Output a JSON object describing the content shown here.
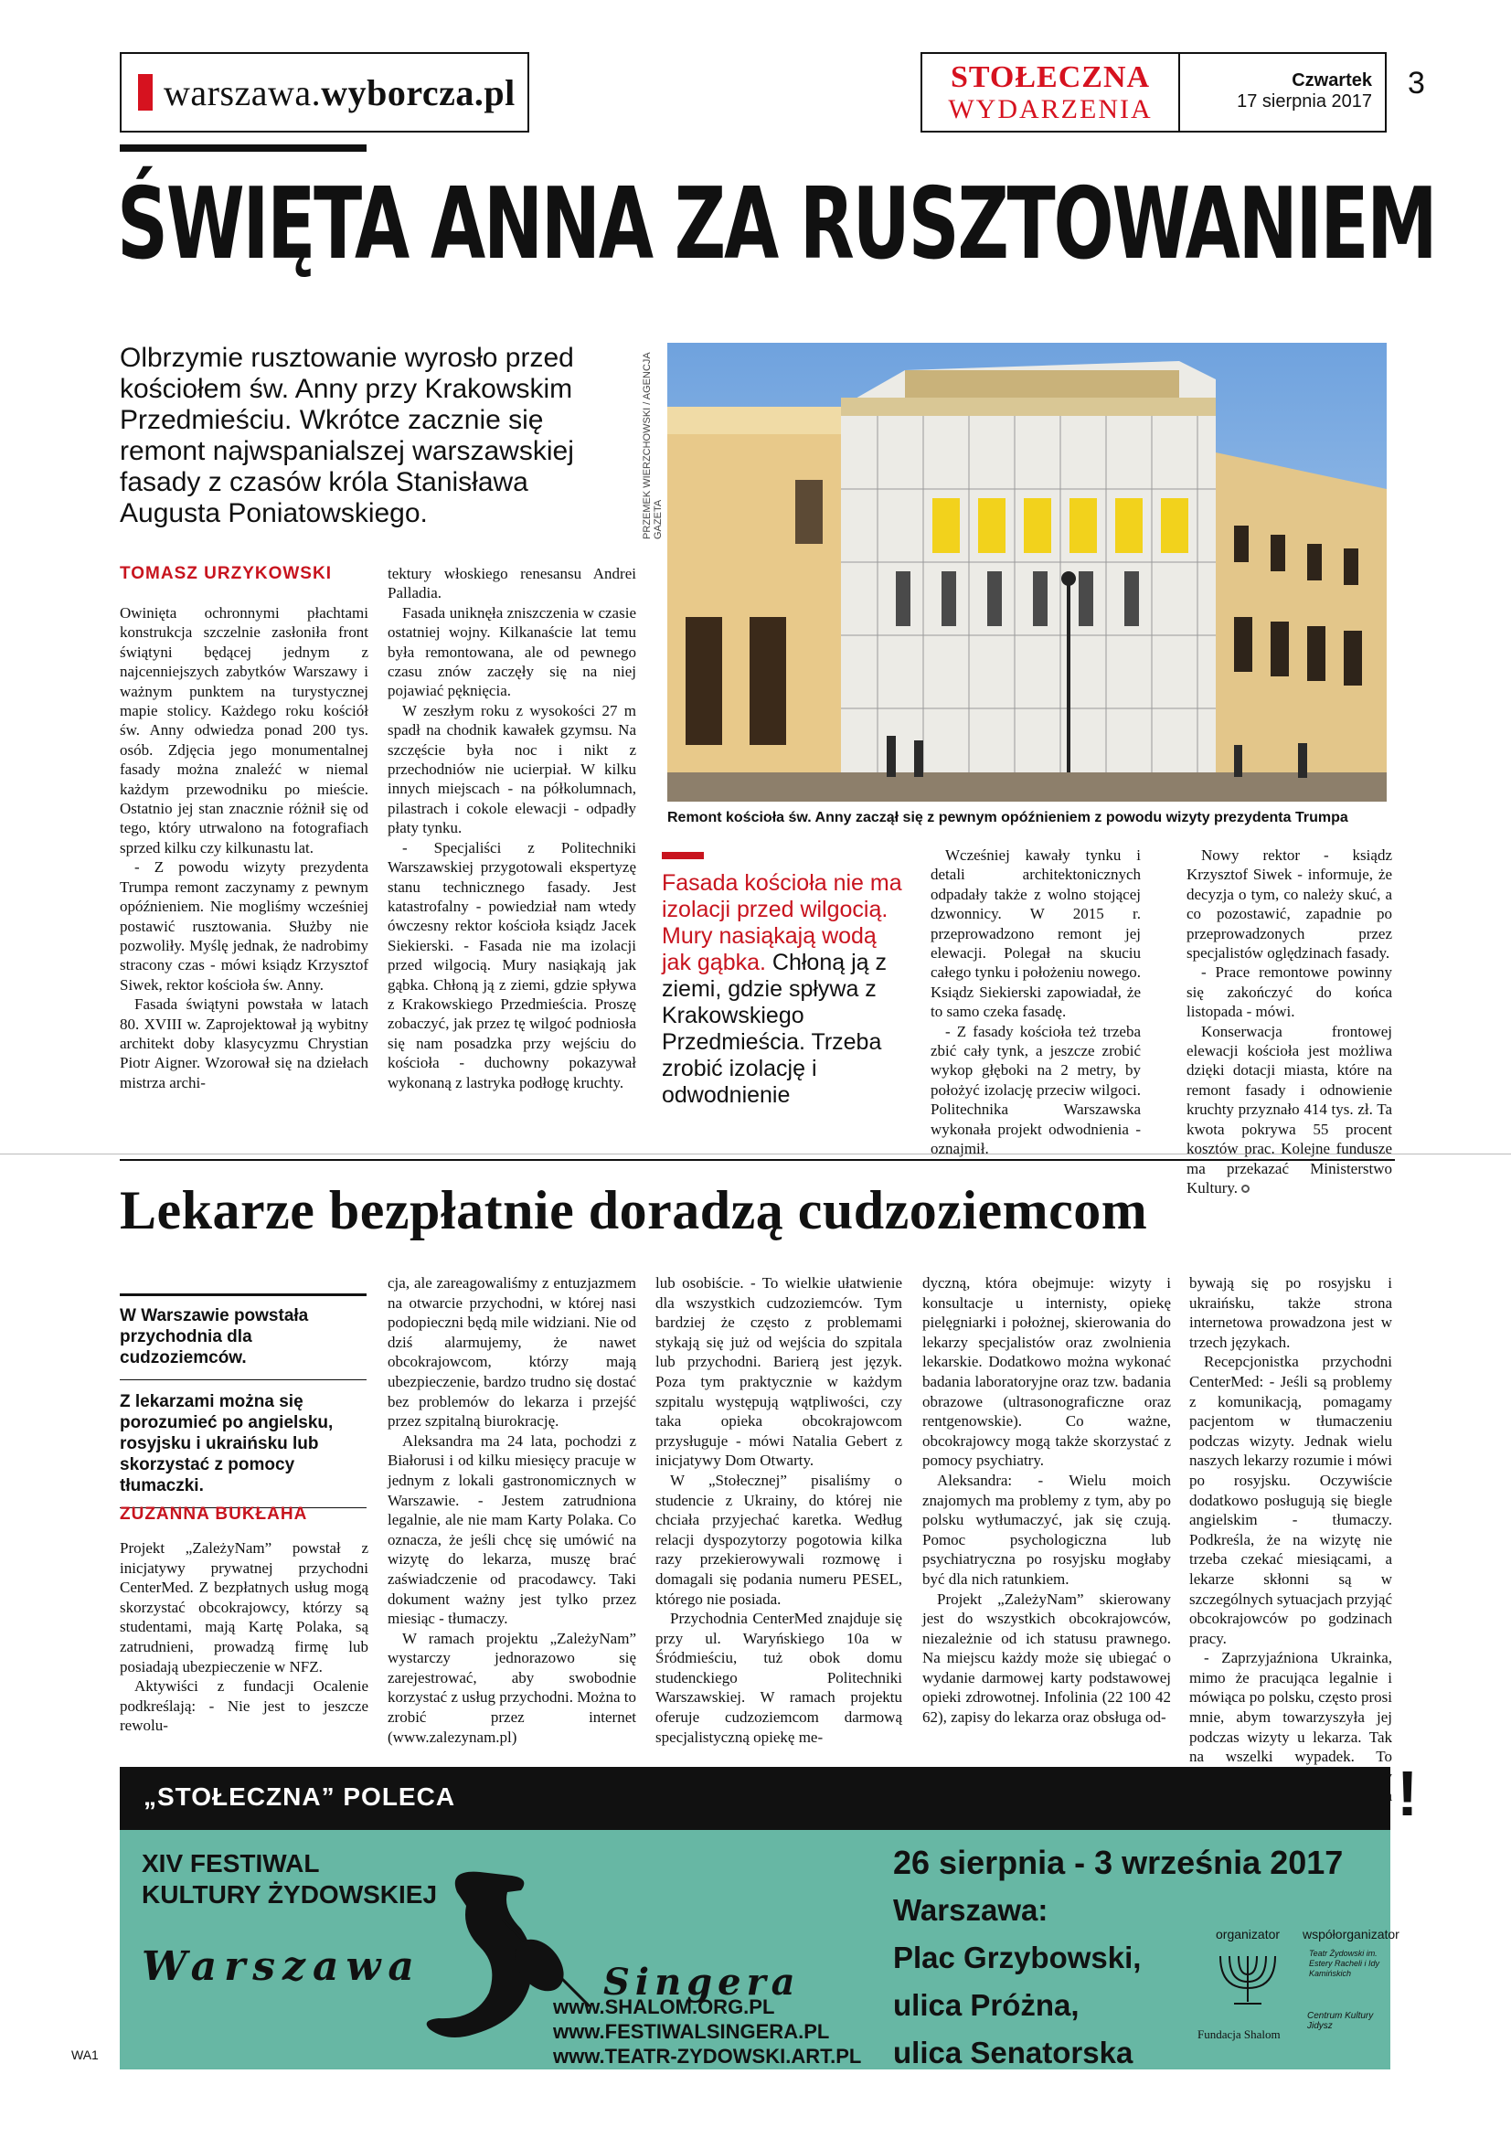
{
  "masthead": {
    "site_prefix": "warszawa.",
    "site_name": "wyborcza",
    "site_suffix": ".pl",
    "section_line1": "STOŁECZNA",
    "section_line2": "WYDARZENIA",
    "day": "Czwartek",
    "date": "17 sierpnia 2017",
    "page_number": "3"
  },
  "article1": {
    "headline": "ŚWIĘTA ANNA ZA RUSZTOWANIEM",
    "lead": "Olbrzymie rusztowanie wyrosło przed kościołem św. Anny przy Krakowskim Przedmieściu. Wkrótce zacznie się remont najwspanialszej warszawskiej fasady z czasów króla Stanisława Augusta Poniatowskiego.",
    "photo_credit": "PRZEMEK WIERZCHOWSKI / AGENCJA GAZETA",
    "photo_caption": "Remont kościoła św. Anny zaczął się z pewnym opóźnieniem z powodu wizyty prezydenta Trumpa",
    "author": "TOMASZ URZYKOWSKI",
    "col1": [
      "Owinięta ochronnymi płachtami konstrukcja szczelnie zasłoniła front świątyni będącej jednym z najcenniejszych zabytków Warszawy i ważnym punktem na turystycznej mapie stolicy. Każdego roku kościół św. Anny odwiedza ponad 200 tys. osób. Zdjęcia jego monumentalnej fasady można znaleźć w niemal każdym przewodniku po mieście. Ostatnio jej stan znacznie różnił się od tego, który utrwalono na fotografiach sprzed kilku czy kilkunastu lat.",
      "- Z powodu wizyty prezydenta Trumpa remont zaczynamy z pewnym opóźnieniem. Nie mogliśmy wcześniej postawić rusztowania. Służby nie pozwoliły. Myślę jednak, że nadrobimy stracony czas - mówi ksiądz Krzysztof Siwek, rektor kościoła św. Anny.",
      "Fasada świątyni powstała w latach 80. XVIII w. Zaprojektował ją wybitny architekt doby klasycyzmu Chrystian Piotr Aigner. Wzorował się na dziełach mistrza archi-"
    ],
    "col2": [
      "tektury włoskiego renesansu Andrei Palladia.",
      "Fasada uniknęła zniszczenia w czasie ostatniej wojny. Kilkanaście lat temu była remontowana, ale od pewnego czasu znów zaczęły się na niej pojawiać pęknięcia.",
      "W zeszłym roku z wysokości 27 m spadł na chodnik kawałek gzymsu. Na szczęście była noc i nikt z przechodniów nie ucierpiał. W kilku innych miejscach - na półkolumnach, pilastrach i cokole elewacji - odpadły płaty tynku.",
      "- Specjaliści z Politechniki Warszawskiej przygotowali ekspertyzę stanu technicznego fasady. Jest katastrofalny - powiedział nam wtedy ówczesny rektor kościoła ksiądz Jacek Siekierski. - Fasada nie ma izolacji przed wilgocią. Mury nasiąkają jak gąbka. Chłoną ją z ziemi, gdzie spływa z Krakowskiego Przedmieścia. Proszę zobaczyć, jak przez tę wilgoć podniosła się nam posadzka przy wejściu do kościoła - duchowny pokazywał wykonaną z lastryka podłogę kruchty."
    ],
    "pull_red": "Fasada kościoła nie ma izolacji przed wilgocią. Mury nasiąkają wodą jak gąbka.",
    "pull_black": "Chłoną ją z ziemi, gdzie spływa z Krakowskiego Przedmieścia. Trzeba zrobić izolację i odwodnienie",
    "col3": [
      "Wcześniej kawały tynku i detali architektonicznych odpadały także z wolno stojącej dzwonnicy. W 2015 r. przeprowadzono remont jej elewacji. Polegał na skuciu całego tynku i położeniu nowego. Ksiądz Siekierski zapowiadał, że to samo czeka fasadę.",
      "- Z fasady kościoła też trzeba zbić cały tynk, a jeszcze zrobić wykop głęboki na 2 metry, by położyć izolację przeciw wilgoci. Politechnika Warszawska wykonała projekt odwodnienia - oznajmił."
    ],
    "col4": [
      "Nowy rektor - ksiądz Krzysztof Siwek - informuje, że decyzja o tym, co należy skuć, a co pozostawić, zapadnie po przeprowadzonych przez specjalistów oględzinach fasady.",
      "- Prace remontowe powinny się zakończyć do końca listopada - mówi.",
      "Konserwacja frontowej elewacji kościoła jest możliwa dzięki dotacji miasta, które na remont fasady i odnowienie kruchty przyznało 414 tys. zł. Ta kwota pokrywa 55 procent kosztów prac. Kolejne fundusze ma przekazać Ministerstwo Kultury."
    ]
  },
  "article2": {
    "headline": "Lekarze bezpłatnie doradzą cudzoziemcom",
    "box1": "W Warszawie powstała przychodnia dla cudzoziemców.",
    "box2": "Z lekarzami można się porozumieć po angielsku, rosyjsku i ukraińsku lub skorzystać z pomocy tłumaczki.",
    "author": "ZUZANNA BUKŁAHA",
    "col1": [
      "Projekt „ZależyNam” powstał z inicjatywy prywatnej przychodni CenterMed. Z bezpłatnych usług mogą skorzystać obcokrajowcy, którzy są studentami, mają Kartę Polaka, są zatrudnieni, prowadzą firmę lub posiadają ubezpieczenie w NFZ.",
      "Aktywiści z fundacji Ocalenie podkreślają: - Nie jest to jeszcze rewolu-"
    ],
    "col2": [
      "cja, ale zareagowaliśmy z entuzjazmem na otwarcie przychodni, w której nasi podopieczni będą mile widziani. Nie od dziś alarmujemy, że nawet obcokrajowcom, którzy mają ubezpieczenie, bardzo trudno się dostać bez problemów do lekarza i przejść przez szpitalną biurokrację.",
      "Aleksandra ma 24 lata, pochodzi z Białorusi i od kilku miesięcy pracuje w jednym z lokali gastronomicznych w Warszawie. - Jestem zatrudniona legalnie, ale nie mam Karty Polaka. Co oznacza, że jeśli chcę się umówić na wizytę do lekarza, muszę brać zaświadczenie od pracodawcy. Taki dokument ważny jest tylko przez miesiąc - tłumaczy.",
      "W ramach projektu „ZależyNam” wystarczy jednorazowo się zarejestrować, aby swobodnie korzystać z usług przychodni. Można to zrobić przez internet (www.zalezynam.pl)"
    ],
    "col3": [
      "lub osobiście. - To wielkie ułatwienie dla wszystkich cudzoziemców. Tym bardziej że często z problemami stykają się już od wejścia do szpitala lub przychodni. Barierą jest język. Poza tym praktycznie w każdym szpitalu występują wątpliwości, czy taka opieka obcokrajowcom przysługuje - mówi Natalia Gebert z inicjatywy Dom Otwarty.",
      "W „Stołecznej” pisaliśmy o studencie z Ukrainy, do której nie chciała przyjechać karetka. Według relacji dyspozytorzy pogotowia kilka razy przekierowywali rozmowę i domagali się podania numeru PESEL, którego nie posiada.",
      "Przychodnia CenterMed znajduje się przy ul. Waryńskiego 10a w Śródmieściu, tuż obok domu studenckiego Politechniki Warszawskiej. W ramach projektu oferuje cudzoziemcom darmową specjalistyczną opiekę me-"
    ],
    "col4": [
      "dyczną, która obejmuje: wizyty i konsultacje u internisty, opiekę pielęgniarki i położnej, skierowania do lekarzy specjalistów oraz zwolnienia lekarskie. Dodatkowo można wykonać badania laboratoryjne oraz tzw. badania obrazowe (ultrasonograficzne oraz rentgenowskie). Co ważne, obcokrajowcy mogą także skorzystać z pomocy psychiatry.",
      "Aleksandra: - Wielu moich znajomych ma problemy z tym, aby po polsku wytłumaczyć, jak się czują. Pomoc psychologiczna lub psychiatryczna po rosyjsku mogłaby być dla nich ratunkiem.",
      "Projekt „ZależyNam” skierowany jest do wszystkich obcokrajowców, niezależnie od ich statusu prawnego. Na miejscu każdy może się ubiegać o wydanie darmowej karty podstawowej opieki zdrowotnej. Infolinia (22 100 42 62), zapisy do lekarza oraz obsługa od-"
    ],
    "col5": [
      "bywają się po rosyjsku i ukraińsku, także strona internetowa prowadzona jest w trzech językach.",
      "Recepcjonistka przychodni CenterMed: - Jeśli są problemy z komunikacją, pomagamy pacjentom w tłumaczeniu podczas wizyty. Jednak wielu naszych lekarzy rozumie i mówi po rosyjsku. Oczywiście dodatkowo posługują się biegle angielskim - tłumaczy. Podkreśla, że na wizytę nie trzeba czekać miesiącami, a lekarze skłonni są w szczególnych sytuacjach przyjąć obcokrajowców po godzinach pracy.",
      "- Zaprzyjaźniona Ukrainka, mimo że pracująca legalnie i mówiąca po polsku, często prosi mnie, abym towarzyszyła jej podczas wizyty u lekarza. Tak na wszelki wypadek. To pokazuje, jak ważne jest, aby takie przyjazne miejsca powstawały - dodaje Gebert."
    ]
  },
  "ad": {
    "label": "„STOŁECZNA” POLECA",
    "exclamation": "!",
    "festival_title_1": "XIV FESTIWAL",
    "festival_title_2": "KULTURY ŻYDOWSKIEJ",
    "logo_1": "Warszawa",
    "logo_2": "Singera",
    "urls": [
      "www.SHALOM.ORG.PL",
      "www.FESTIWALSINGERA.PL",
      "www.TEATR-ZYDOWSKI.ART.PL"
    ],
    "dates": "26 sierpnia - 3 września 2017",
    "city": "Warszawa:",
    "places": [
      "Plac Grzybowski,",
      "ulica Próżna,",
      "ulica Senatorska"
    ],
    "organizer_label": "organizator",
    "coorganizer_label": "współorganizator",
    "organizer_name": "Fundacja Shalom",
    "coorganizer_name": "Centrum Kultury Jidysz",
    "coorganizer_top": "Teatr Żydowski im. Estery Racheli i Idy Kamińskich"
  },
  "footer": {
    "edition": "WA1"
  }
}
